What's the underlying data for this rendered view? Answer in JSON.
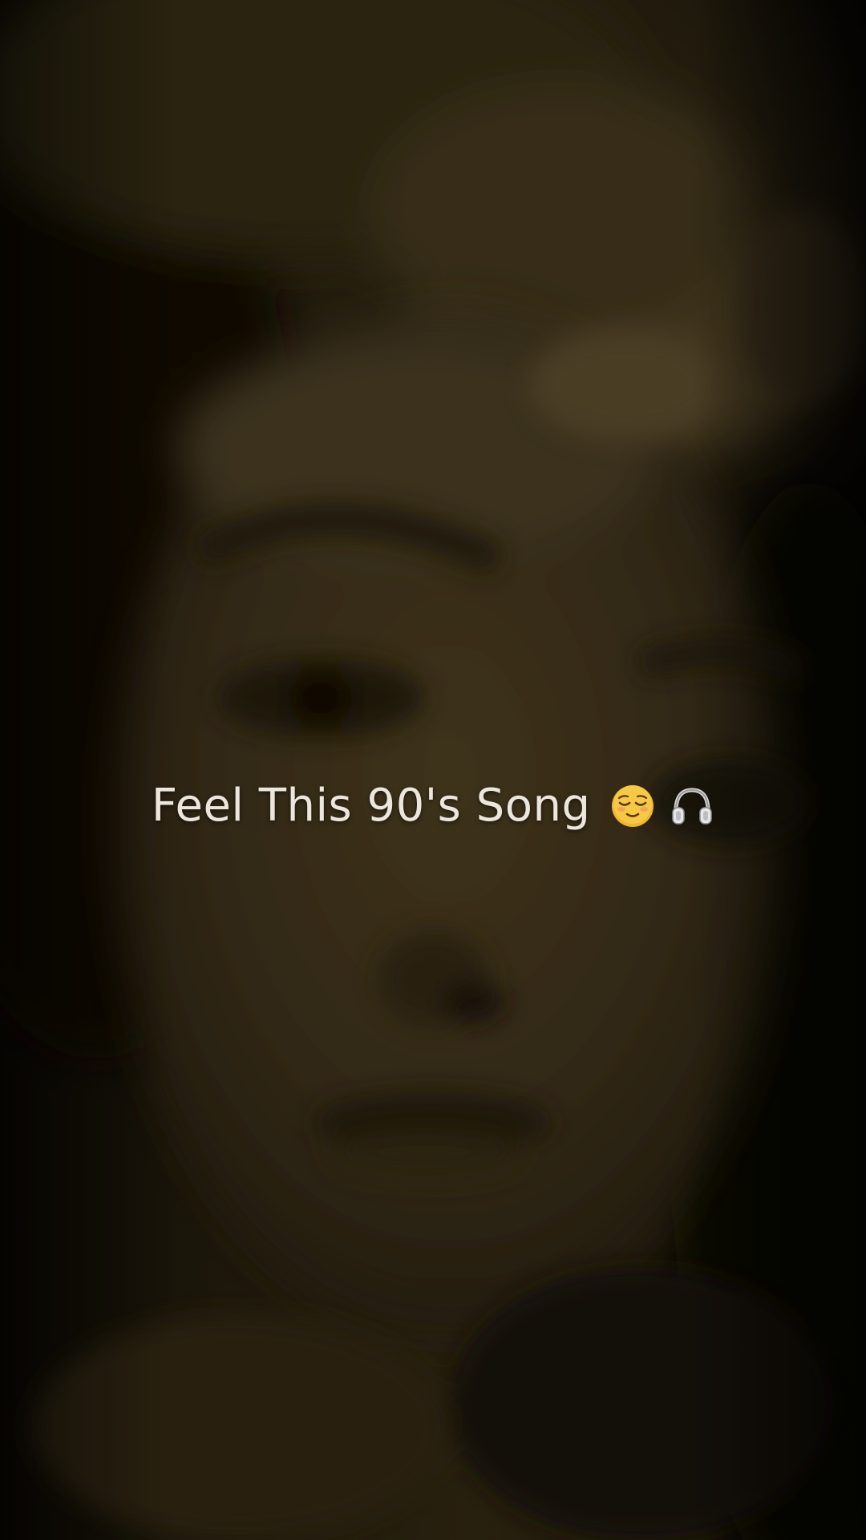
{
  "overlay": {
    "caption": "Feel This 90's Song",
    "emojis": [
      "relieved-face-icon",
      "headphones-icon"
    ]
  },
  "background": {
    "description_tone": "sepia",
    "colors": {
      "dark": "#120e05",
      "mid": "#3a2f16",
      "light": "#4b3d1f",
      "text": "#ece6dc",
      "emoji_face": "#f2b531"
    }
  }
}
